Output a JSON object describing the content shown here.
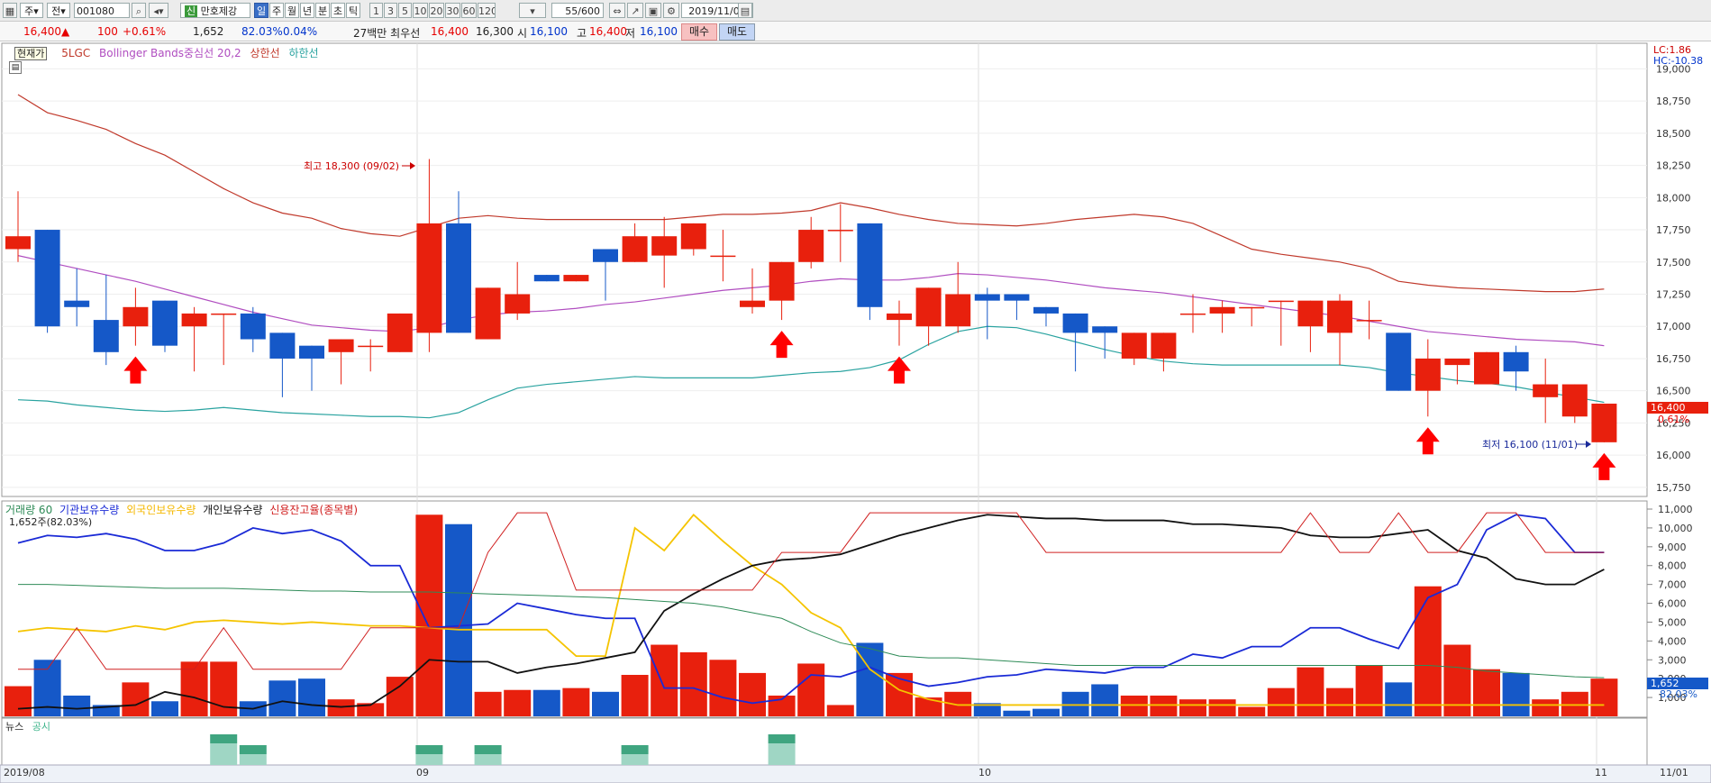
{
  "toolbar": {
    "mode1": "주",
    "mode2": "전",
    "code": "001080",
    "name": "만호제강",
    "period_tabs": [
      "일",
      "주",
      "월",
      "년",
      "분",
      "초",
      "틱"
    ],
    "selected_tab": "일",
    "intervals": [
      "1",
      "3",
      "5",
      "10",
      "20",
      "30",
      "60",
      "120"
    ],
    "count": "55/600",
    "date": "2019/11/01"
  },
  "quote": {
    "price": "16,400",
    "arrow": "▲",
    "change": "100",
    "change_pct": "+0.61%",
    "volume": "1,652",
    "ratio1": "82.03%",
    "ratio2": "0.04%",
    "summary": "27백만 최우선",
    "best_ask": "16,400",
    "best_bid": "16,300",
    "open_label": "시",
    "open": "16,100",
    "high_label": "고",
    "high": "16,400",
    "low_label": "저",
    "low": "16,100",
    "buy_label": "매수",
    "sell_label": "매도"
  },
  "price_panel": {
    "tooltip": "현재가",
    "legend_5lgc": "5LGC",
    "legend_bb": "Bollinger Bands중심선 20,2",
    "legend_upper": "상한선",
    "legend_lower": "하한선",
    "lc": "LC:1.86",
    "hc": "HC:-10.38",
    "current_price_tag": "16,400",
    "current_pct_tag": "0.61%",
    "high_annotation": "최고 18,300 (09/02)",
    "low_annotation": "최저 16,100 (11/01)"
  },
  "volume_panel": {
    "legend": [
      "거래량 60",
      "기관보유수량",
      "외국인보유수량",
      "개인보유수량",
      "신용잔고율(종목별)"
    ],
    "info": "1,652주(82.03%)",
    "right_tag": "1,652",
    "right_pct": "82.03%"
  },
  "news_panel": {
    "legend_news": "뉴스",
    "legend_notice": "공시"
  },
  "x_axis": [
    "2019/08",
    "09",
    "10",
    "11",
    "11/01"
  ],
  "colors": {
    "up": "#e8200d",
    "down": "#1558c8",
    "upper": "#c0392b",
    "mid": "#b04dc0",
    "lower": "#2aa3a0"
  },
  "chart_data": [
    {
      "type": "candlestick",
      "title": "",
      "y_ticks": [
        15750,
        16000,
        16250,
        16500,
        16750,
        17000,
        17250,
        17500,
        17750,
        18000,
        18250,
        18500,
        18750,
        19000
      ],
      "ylim": [
        15700,
        19150
      ],
      "candles": [
        [
          17600,
          17700,
          18050,
          17500
        ],
        [
          17750,
          17000,
          17750,
          16950
        ],
        [
          17200,
          17150,
          17450,
          17000
        ],
        [
          17050,
          16800,
          17400,
          16700
        ],
        [
          17000,
          17150,
          17300,
          16850
        ],
        [
          17200,
          16850,
          17200,
          16800
        ],
        [
          17000,
          17100,
          17150,
          16650
        ],
        [
          17100,
          17100,
          17100,
          16700
        ],
        [
          17100,
          16900,
          17150,
          16800
        ],
        [
          16950,
          16750,
          16950,
          16450
        ],
        [
          16850,
          16750,
          16850,
          16500
        ],
        [
          16800,
          16900,
          16900,
          16550
        ],
        [
          16850,
          16850,
          16900,
          16650
        ],
        [
          16800,
          17100,
          17100,
          16800
        ],
        [
          16950,
          17800,
          18300,
          16800
        ],
        [
          17800,
          16950,
          18050,
          16950
        ],
        [
          16900,
          17300,
          17300,
          16900
        ],
        [
          17100,
          17250,
          17500,
          17050
        ],
        [
          17400,
          17350,
          17400,
          17350
        ],
        [
          17350,
          17400,
          17400,
          17350
        ],
        [
          17600,
          17500,
          17600,
          17200
        ],
        [
          17500,
          17700,
          17800,
          17500
        ],
        [
          17550,
          17700,
          17850,
          17300
        ],
        [
          17600,
          17800,
          17800,
          17550
        ],
        [
          17550,
          17550,
          17750,
          17350
        ],
        [
          17150,
          17200,
          17450,
          17100
        ],
        [
          17200,
          17500,
          17500,
          17050
        ],
        [
          17500,
          17750,
          17850,
          17450
        ],
        [
          17750,
          17750,
          17950,
          17500
        ],
        [
          17800,
          17150,
          17800,
          17050
        ],
        [
          17050,
          17100,
          17200,
          16850
        ],
        [
          17000,
          17300,
          17300,
          16850
        ],
        [
          17000,
          17250,
          17500,
          16950
        ],
        [
          17250,
          17200,
          17300,
          16900
        ],
        [
          17250,
          17200,
          17250,
          17050
        ],
        [
          17150,
          17100,
          17150,
          17000
        ],
        [
          17100,
          16950,
          17100,
          16650
        ],
        [
          17000,
          16950,
          17000,
          16750
        ],
        [
          16750,
          16950,
          16950,
          16700
        ],
        [
          16750,
          16950,
          16950,
          16650
        ],
        [
          17100,
          17100,
          17250,
          16950
        ],
        [
          17100,
          17150,
          17200,
          16950
        ],
        [
          17150,
          17150,
          17150,
          17000
        ],
        [
          17200,
          17200,
          17200,
          16850
        ],
        [
          17000,
          17200,
          17200,
          16800
        ],
        [
          16950,
          17200,
          17250,
          16700
        ],
        [
          17050,
          17050,
          17200,
          16900
        ],
        [
          16950,
          16500,
          16950,
          16500
        ],
        [
          16500,
          16750,
          16900,
          16300
        ],
        [
          16700,
          16750,
          16700,
          16550
        ],
        [
          16550,
          16800,
          16800,
          16550
        ],
        [
          16800,
          16650,
          16850,
          16500
        ],
        [
          16450,
          16550,
          16750,
          16250
        ],
        [
          16300,
          16550,
          16550,
          16250
        ],
        [
          16100,
          16400,
          16400,
          16100
        ]
      ],
      "bollinger_upper": [
        18800,
        18660,
        18600,
        18530,
        18420,
        18330,
        18200,
        18070,
        17960,
        17880,
        17840,
        17760,
        17720,
        17700,
        17770,
        17840,
        17860,
        17840,
        17830,
        17830,
        17830,
        17830,
        17830,
        17850,
        17870,
        17870,
        17880,
        17900,
        17960,
        17920,
        17870,
        17830,
        17800,
        17790,
        17780,
        17800,
        17830,
        17850,
        17870,
        17850,
        17800,
        17700,
        17600,
        17560,
        17530,
        17500,
        17450,
        17350,
        17320,
        17300,
        17290,
        17280,
        17270,
        17270,
        17290
      ],
      "bollinger_mid": [
        17550,
        17500,
        17450,
        17400,
        17350,
        17290,
        17230,
        17170,
        17110,
        17060,
        17010,
        16990,
        16970,
        16960,
        16990,
        17050,
        17090,
        17110,
        17120,
        17140,
        17170,
        17190,
        17220,
        17250,
        17280,
        17300,
        17320,
        17350,
        17370,
        17360,
        17360,
        17380,
        17410,
        17400,
        17380,
        17360,
        17330,
        17300,
        17280,
        17260,
        17230,
        17200,
        17170,
        17140,
        17110,
        17080,
        17040,
        17000,
        16960,
        16940,
        16920,
        16900,
        16890,
        16880,
        16850
      ],
      "bollinger_lower": [
        16430,
        16420,
        16390,
        16370,
        16350,
        16340,
        16350,
        16370,
        16350,
        16330,
        16320,
        16310,
        16300,
        16300,
        16290,
        16330,
        16430,
        16520,
        16550,
        16570,
        16590,
        16610,
        16600,
        16600,
        16600,
        16600,
        16620,
        16640,
        16650,
        16680,
        16740,
        16860,
        16960,
        17000,
        16990,
        16940,
        16880,
        16820,
        16770,
        16730,
        16710,
        16700,
        16700,
        16700,
        16700,
        16700,
        16680,
        16640,
        16610,
        16580,
        16560,
        16530,
        16490,
        16450,
        16410
      ]
    },
    {
      "type": "bar",
      "title": "",
      "y_ticks": [
        1000,
        2000,
        3000,
        4000,
        5000,
        6000,
        7000,
        8000,
        9000,
        10000,
        11000
      ],
      "y_tick_labels": [
        "1,000",
        "2,000",
        "3,000",
        "4,000",
        "5,000",
        "6,000",
        "7,000",
        "8,000",
        "9,000",
        "10,000",
        "11,000"
      ],
      "ylim": [
        0,
        11000
      ],
      "volume": [
        1600,
        3000,
        1100,
        600,
        1800,
        800,
        2900,
        2900,
        800,
        1900,
        2000,
        900,
        700,
        2100,
        10700,
        10200,
        1300,
        1400,
        1400,
        1500,
        1300,
        2200,
        3800,
        3400,
        3000,
        2300,
        1100,
        2800,
        600,
        3900,
        2300,
        1000,
        1300,
        700,
        300,
        400,
        1300,
        1700,
        1100,
        1100,
        900,
        900,
        500,
        1500,
        2600,
        1500,
        2700,
        1800,
        6900,
        3800,
        2500,
        2300,
        900,
        1300,
        2000,
        2100
      ],
      "series": [
        {
          "name": "기관보유수량",
          "values": [
            9200,
            9600,
            9500,
            9700,
            9400,
            8800,
            8800,
            9200,
            10000,
            9700,
            9900,
            9300,
            8000,
            8000,
            4700,
            4800,
            4900,
            6000,
            5700,
            5400,
            5200,
            5200,
            1500,
            1500,
            1000,
            700,
            900,
            2200,
            2100,
            2600,
            2000,
            1600,
            1800,
            2100,
            2200,
            2500,
            2400,
            2300,
            2600,
            2600,
            3300,
            3100,
            3700,
            3700,
            4700,
            4700,
            4100,
            3600,
            6300,
            7000,
            9900,
            10700,
            10500,
            8700,
            8700
          ]
        },
        {
          "name": "외국인보유수량",
          "values": [
            4500,
            4700,
            4600,
            4500,
            4800,
            4600,
            5000,
            5100,
            5000,
            4900,
            5000,
            4900,
            4800,
            4800,
            4700,
            4600,
            4600,
            4600,
            4600,
            3200,
            3200,
            10000,
            8800,
            10700,
            9300,
            8000,
            7000,
            5500,
            4700,
            2500,
            1400,
            900,
            600,
            600,
            600,
            600,
            600,
            600,
            600,
            600,
            600,
            600,
            600,
            600,
            600,
            600,
            600,
            600,
            600,
            600,
            600,
            600,
            600,
            600,
            600
          ]
        },
        {
          "name": "개인보유수량",
          "values": [
            400,
            500,
            400,
            500,
            600,
            1300,
            1000,
            500,
            400,
            800,
            600,
            500,
            600,
            1600,
            3000,
            2900,
            2900,
            2300,
            2600,
            2800,
            3100,
            3400,
            5600,
            6500,
            7300,
            8000,
            8300,
            8400,
            8600,
            9100,
            9600,
            10000,
            10400,
            10700,
            10600,
            10500,
            10500,
            10400,
            10400,
            10400,
            10200,
            10200,
            10100,
            10000,
            9600,
            9500,
            9500,
            9700,
            9900,
            8800,
            8400,
            7300,
            7000,
            7000,
            7800
          ]
        },
        {
          "name": "신용잔고율(종목별)",
          "values": [
            2500,
            2500,
            4700,
            2500,
            2500,
            2500,
            2500,
            4700,
            2500,
            2500,
            2500,
            2500,
            4700,
            4700,
            4700,
            4700,
            8700,
            10800,
            10800,
            6700,
            6700,
            6700,
            6700,
            6700,
            6700,
            6700,
            8700,
            8700,
            8700,
            10800,
            10800,
            10800,
            10800,
            10800,
            10800,
            8700,
            8700,
            8700,
            8700,
            8700,
            8700,
            8700,
            8700,
            8700,
            10800,
            8700,
            8700,
            10800,
            8700,
            8700,
            10800,
            10800,
            8700,
            8700,
            8700
          ]
        },
        {
          "name": "거래량 60",
          "values": [
            7000,
            7000,
            6950,
            6900,
            6850,
            6800,
            6800,
            6800,
            6750,
            6700,
            6650,
            6650,
            6600,
            6600,
            6600,
            6550,
            6500,
            6450,
            6400,
            6350,
            6300,
            6200,
            6100,
            6000,
            5800,
            5500,
            5200,
            4500,
            3900,
            3600,
            3200,
            3100,
            3100,
            3000,
            2900,
            2800,
            2700,
            2700,
            2700,
            2700,
            2700,
            2700,
            2700,
            2700,
            2700,
            2700,
            2700,
            2700,
            2700,
            2600,
            2400,
            2300,
            2200,
            2100,
            2050
          ]
        }
      ]
    }
  ]
}
